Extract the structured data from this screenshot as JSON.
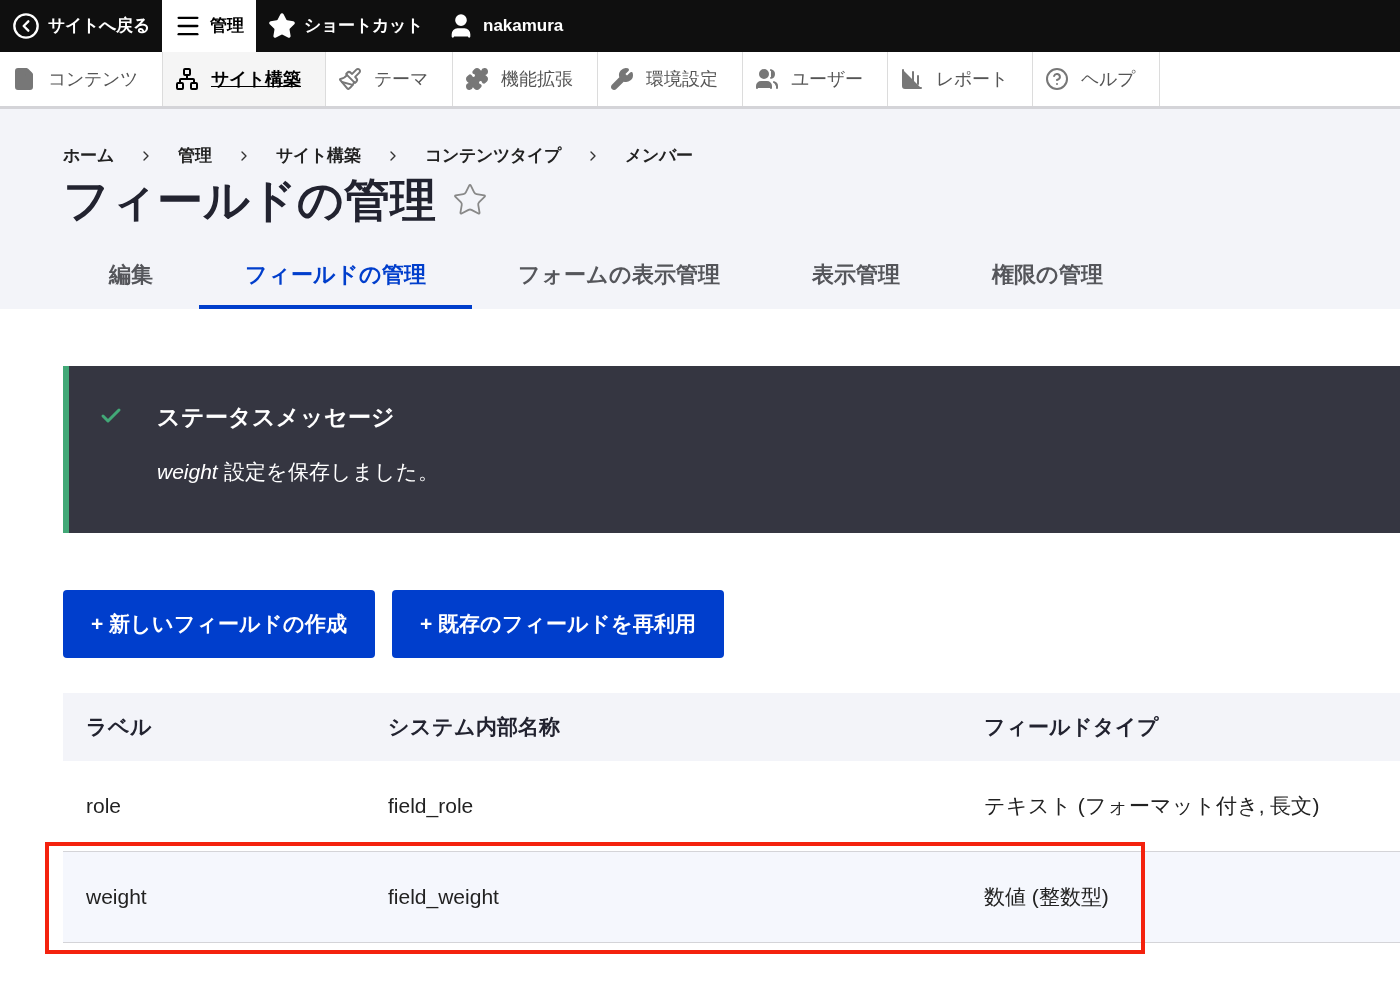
{
  "top_bar": {
    "items": [
      {
        "label": "サイトへ戻る",
        "kind": "back",
        "selected": false
      },
      {
        "label": "管理",
        "kind": "menu",
        "selected": true
      },
      {
        "label": "ショートカット",
        "kind": "star",
        "selected": false
      },
      {
        "label": "nakamura",
        "kind": "user",
        "selected": false
      }
    ]
  },
  "admin_menu": {
    "items": [
      {
        "label": "コンテンツ",
        "kind": "file",
        "selected": false
      },
      {
        "label": "サイト構築",
        "kind": "structure",
        "selected": true
      },
      {
        "label": "テーマ",
        "kind": "brush",
        "selected": false
      },
      {
        "label": "機能拡張",
        "kind": "puzzle",
        "selected": false
      },
      {
        "label": "環境設定",
        "kind": "wrench",
        "selected": false
      },
      {
        "label": "ユーザー",
        "kind": "users",
        "selected": false
      },
      {
        "label": "レポート",
        "kind": "chart",
        "selected": false
      },
      {
        "label": "ヘルプ",
        "kind": "help",
        "selected": false
      }
    ]
  },
  "breadcrumb": [
    "ホーム",
    "管理",
    "サイト構築",
    "コンテンツタイプ",
    "メンバー"
  ],
  "page_title": "フィールドの管理",
  "tabs": [
    {
      "label": "編集",
      "selected": false
    },
    {
      "label": "フィールドの管理",
      "selected": true
    },
    {
      "label": "フォームの表示管理",
      "selected": false
    },
    {
      "label": "表示管理",
      "selected": false
    },
    {
      "label": "権限の管理",
      "selected": false
    }
  ],
  "status_message": {
    "title": "ステータスメッセージ",
    "text": "*weight* 設定を保存しました。"
  },
  "buttons": [
    "+ 新しいフィールドの作成",
    "+ 既存のフィールドを再利用"
  ],
  "table": {
    "columns": [
      "ラベル",
      "システム内部名称",
      "フィールドタイプ"
    ],
    "rows": [
      {
        "cells": [
          "role",
          "field_role",
          "テキスト (フォーマット付き, 長文)"
        ],
        "highlighted": false
      },
      {
        "cells": [
          "weight",
          "field_weight",
          "数値 (整数型)"
        ],
        "highlighted": true
      }
    ]
  }
}
